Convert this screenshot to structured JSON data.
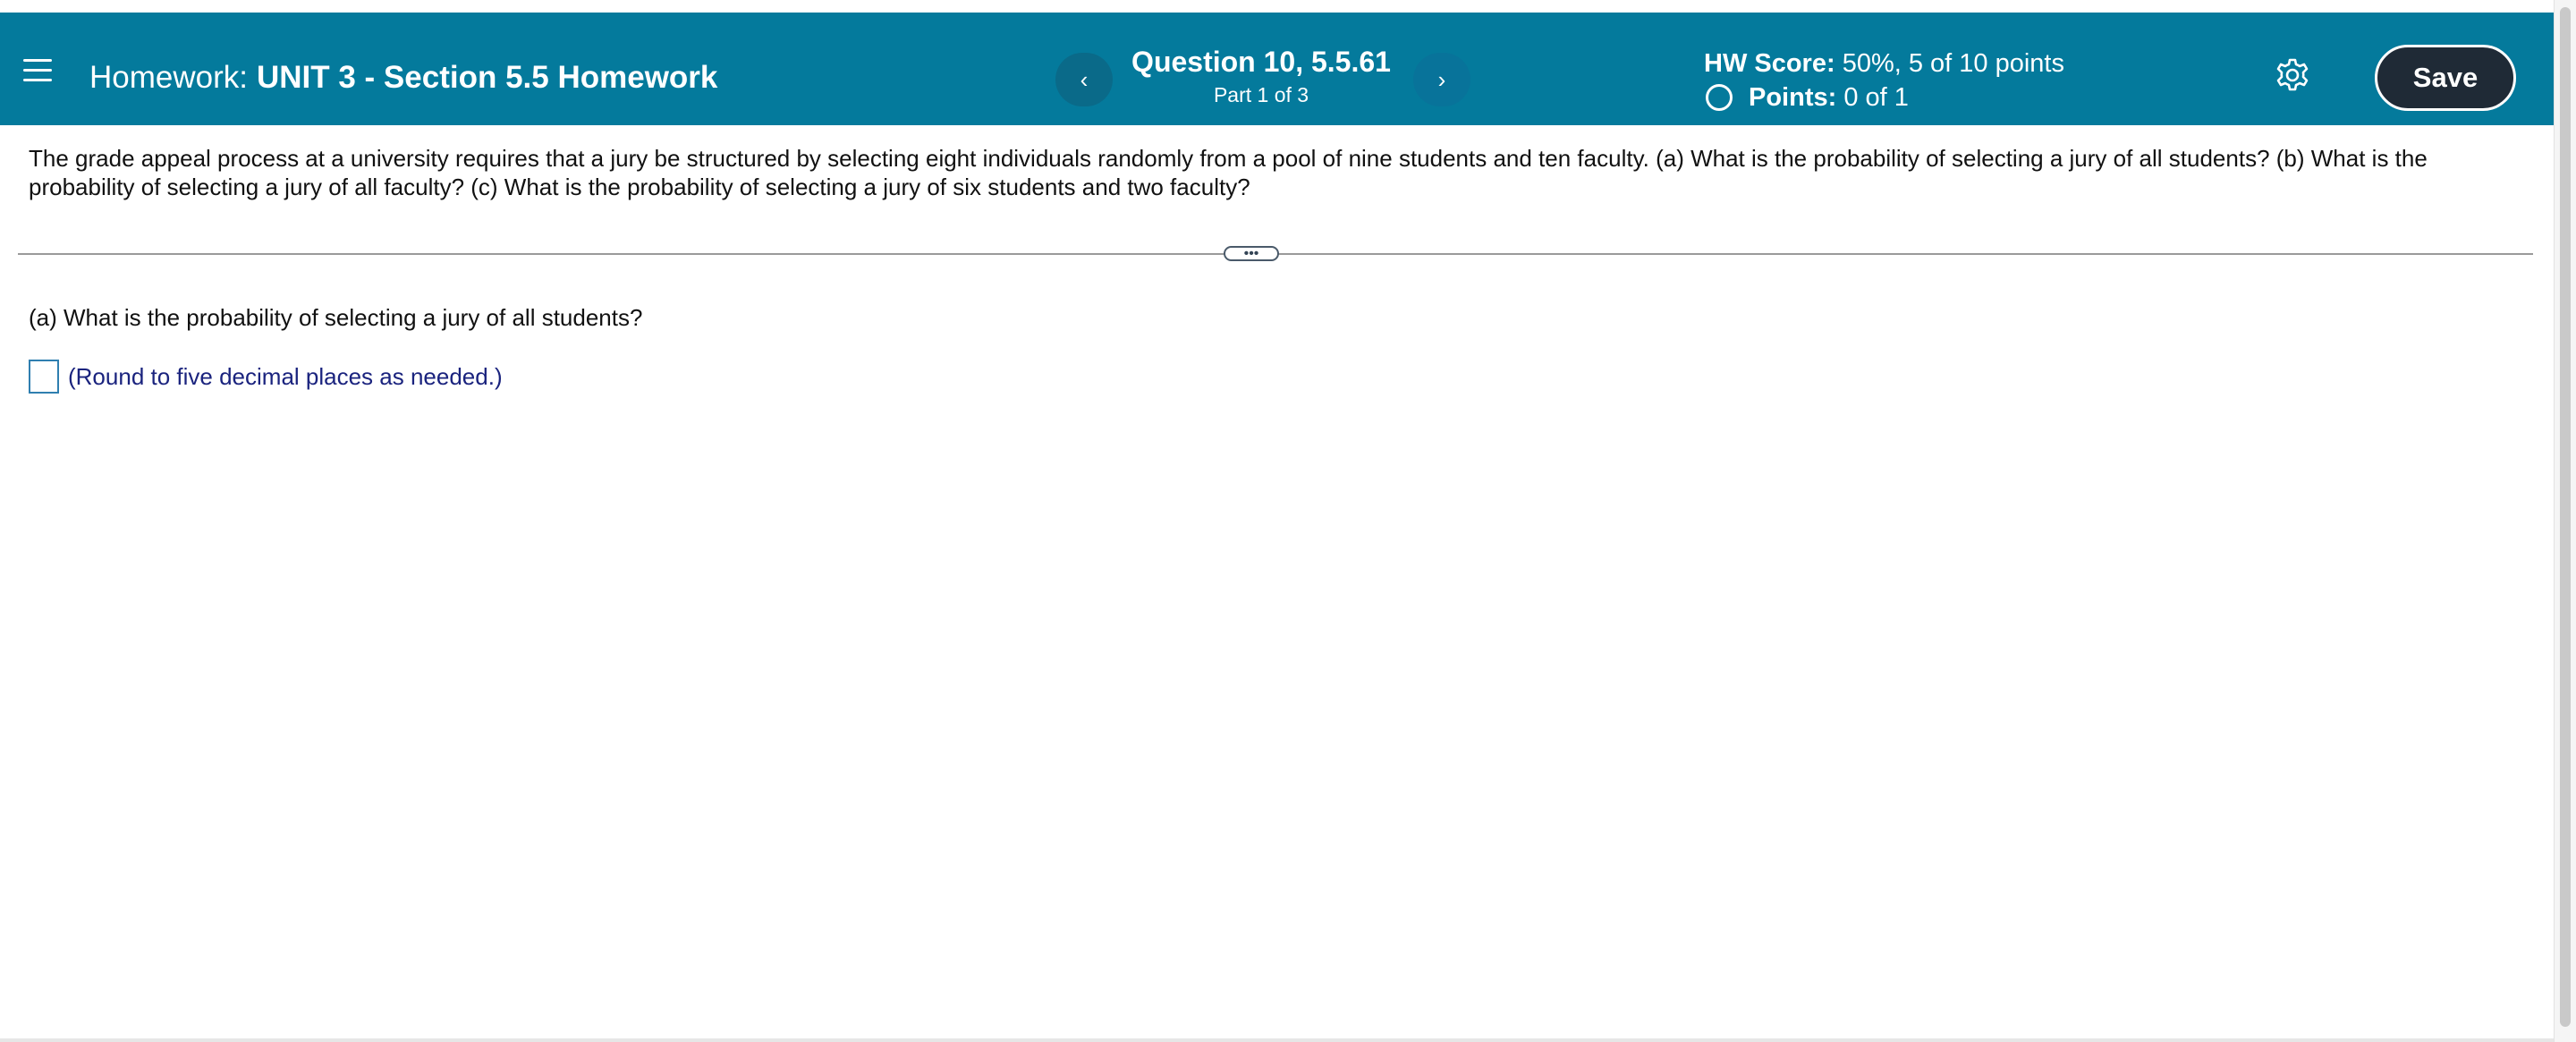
{
  "header": {
    "hw_prefix": "Homework:",
    "hw_name": "UNIT 3 - Section 5.5 Homework",
    "question_title": "Question 10, 5.5.61",
    "question_part": "Part 1 of 3",
    "prev_symbol": "‹",
    "next_symbol": "›",
    "score_label": "HW Score:",
    "score_value": "50%, 5 of 10 points",
    "points_label": "Points:",
    "points_value": "0 of 1",
    "save_label": "Save",
    "icons": [
      "menu-icon",
      "chevron-left-icon",
      "chevron-right-icon",
      "circle-icon",
      "gear-icon"
    ],
    "accent_color": "#047a9c",
    "save_color": "#1f2a36"
  },
  "question": {
    "text": "The grade appeal process at a university requires that a jury be structured by selecting eight individuals randomly from a pool of nine students and ten faculty. (a) What is the probability of selecting a jury of all students? (b) What is the probability of selecting a jury of all faculty? (c) What is the probability of selecting a jury of six students and two faculty?",
    "expand_symbol": "•••",
    "part_a": "(a) What is the probability of selecting a jury of all students?",
    "answer_value": "",
    "answer_hint": "(Round to five decimal places as needed.)"
  }
}
